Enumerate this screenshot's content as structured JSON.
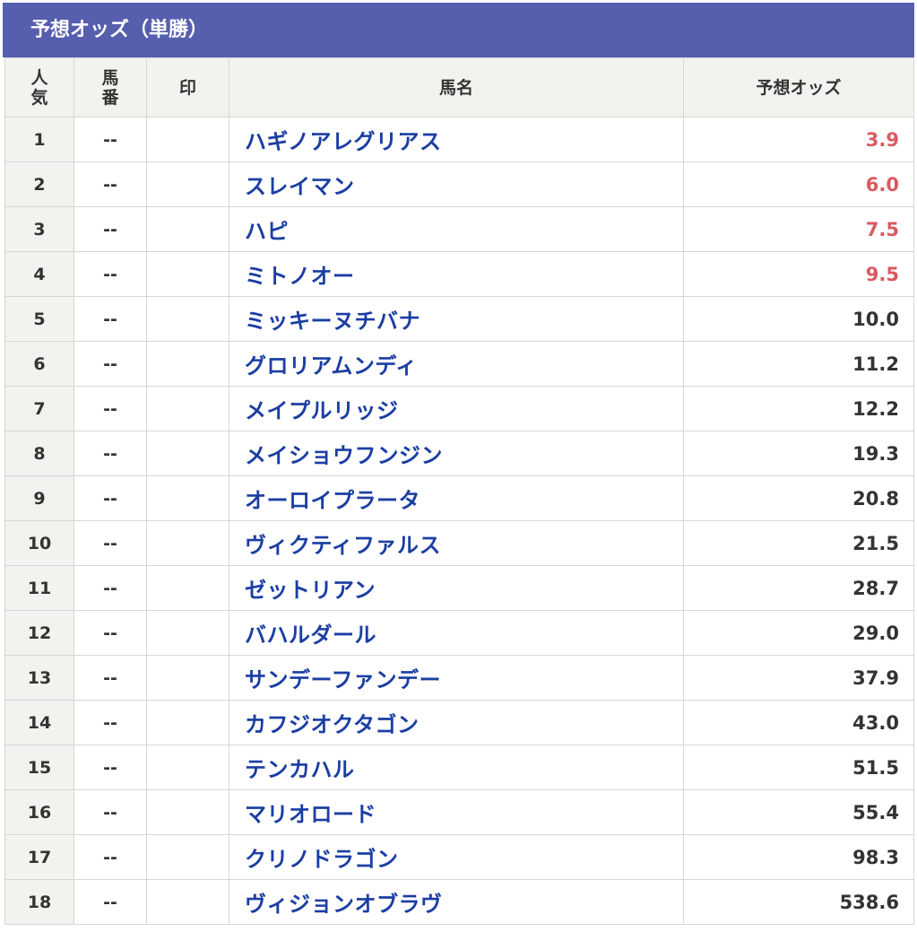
{
  "title": "予想オッズ（単勝）",
  "columns": {
    "popularity": "人\n気",
    "umaban": "馬\n番",
    "mark": "印",
    "name": "馬名",
    "odds": "予想オッズ"
  },
  "colors": {
    "header_bg": "#565eae",
    "name_link": "#1b3ea3",
    "hot_odds": "#d95a61",
    "text": "#333333"
  },
  "rows": [
    {
      "rank": "1",
      "umaban": "--",
      "mark": "",
      "name": "ハギノアレグリアス",
      "odds": "3.9",
      "hot": true
    },
    {
      "rank": "2",
      "umaban": "--",
      "mark": "",
      "name": "スレイマン",
      "odds": "6.0",
      "hot": true
    },
    {
      "rank": "3",
      "umaban": "--",
      "mark": "",
      "name": "ハピ",
      "odds": "7.5",
      "hot": true
    },
    {
      "rank": "4",
      "umaban": "--",
      "mark": "",
      "name": "ミトノオー",
      "odds": "9.5",
      "hot": true
    },
    {
      "rank": "5",
      "umaban": "--",
      "mark": "",
      "name": "ミッキーヌチバナ",
      "odds": "10.0",
      "hot": false
    },
    {
      "rank": "6",
      "umaban": "--",
      "mark": "",
      "name": "グロリアムンディ",
      "odds": "11.2",
      "hot": false
    },
    {
      "rank": "7",
      "umaban": "--",
      "mark": "",
      "name": "メイプルリッジ",
      "odds": "12.2",
      "hot": false
    },
    {
      "rank": "8",
      "umaban": "--",
      "mark": "",
      "name": "メイショウフンジン",
      "odds": "19.3",
      "hot": false
    },
    {
      "rank": "9",
      "umaban": "--",
      "mark": "",
      "name": "オーロイプラータ",
      "odds": "20.8",
      "hot": false
    },
    {
      "rank": "10",
      "umaban": "--",
      "mark": "",
      "name": "ヴィクティファルス",
      "odds": "21.5",
      "hot": false
    },
    {
      "rank": "11",
      "umaban": "--",
      "mark": "",
      "name": "ゼットリアン",
      "odds": "28.7",
      "hot": false
    },
    {
      "rank": "12",
      "umaban": "--",
      "mark": "",
      "name": "バハルダール",
      "odds": "29.0",
      "hot": false
    },
    {
      "rank": "13",
      "umaban": "--",
      "mark": "",
      "name": "サンデーファンデー",
      "odds": "37.9",
      "hot": false
    },
    {
      "rank": "14",
      "umaban": "--",
      "mark": "",
      "name": "カフジオクタゴン",
      "odds": "43.0",
      "hot": false
    },
    {
      "rank": "15",
      "umaban": "--",
      "mark": "",
      "name": "テンカハル",
      "odds": "51.5",
      "hot": false
    },
    {
      "rank": "16",
      "umaban": "--",
      "mark": "",
      "name": "マリオロード",
      "odds": "55.4",
      "hot": false
    },
    {
      "rank": "17",
      "umaban": "--",
      "mark": "",
      "name": "クリノドラゴン",
      "odds": "98.3",
      "hot": false
    },
    {
      "rank": "18",
      "umaban": "--",
      "mark": "",
      "name": "ヴィジョンオブラヴ",
      "odds": "538.6",
      "hot": false
    }
  ]
}
